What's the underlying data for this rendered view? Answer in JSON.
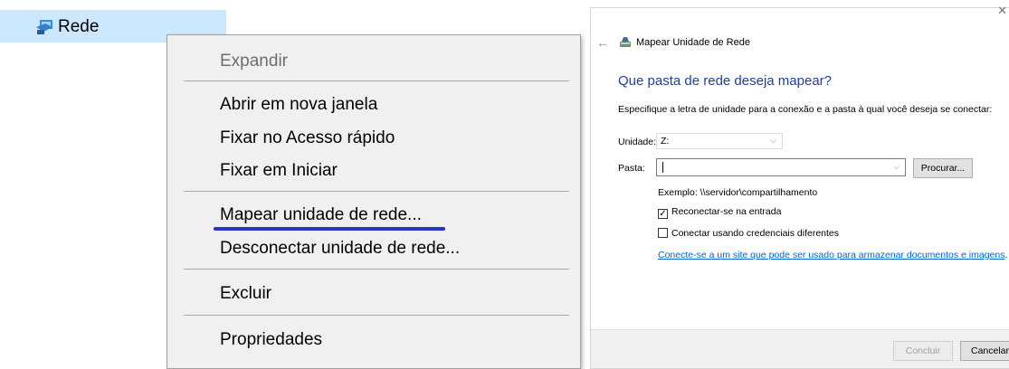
{
  "explorer": {
    "nav_label": "Rede",
    "nav_icon": "network-icon"
  },
  "context_menu": {
    "items": [
      {
        "label": "Expandir",
        "enabled": false
      },
      {
        "label": "Abrir em nova janela",
        "enabled": true
      },
      {
        "label": "Fixar no Acesso rápido",
        "enabled": true
      },
      {
        "label": "Fixar em Iniciar",
        "enabled": true
      },
      {
        "label": "Mapear unidade de rede...",
        "enabled": true
      },
      {
        "label": "Desconectar unidade de rede...",
        "enabled": true
      },
      {
        "label": "Excluir",
        "enabled": true
      },
      {
        "label": "Propriedades",
        "enabled": true
      }
    ],
    "highlight_color": "#2a33c8"
  },
  "dialog": {
    "title": "Mapear Unidade de Rede",
    "heading": "Que pasta de rede deseja mapear?",
    "instruction": "Especifique a letra de unidade para a conexão e a pasta à qual você deseja se conectar:",
    "drive_label": "Unidade:",
    "drive_value": "Z:",
    "folder_label": "Pasta:",
    "folder_value": "",
    "browse_label": "Procurar...",
    "example": "Exemplo: \\\\servidor\\compartilhamento",
    "reconnect_label": "Reconectar-se na entrada",
    "reconnect_checked": true,
    "credentials_label": "Conectar usando credenciais diferentes",
    "credentials_checked": false,
    "link_text": "Conecte-se a um site que pode ser usado para armazenar documentos e imagens",
    "link_suffix": ".",
    "finish_label": "Concluir",
    "cancel_label": "Cancelar",
    "heading_color": "#1f3fa8",
    "link_color": "#0066cc"
  }
}
